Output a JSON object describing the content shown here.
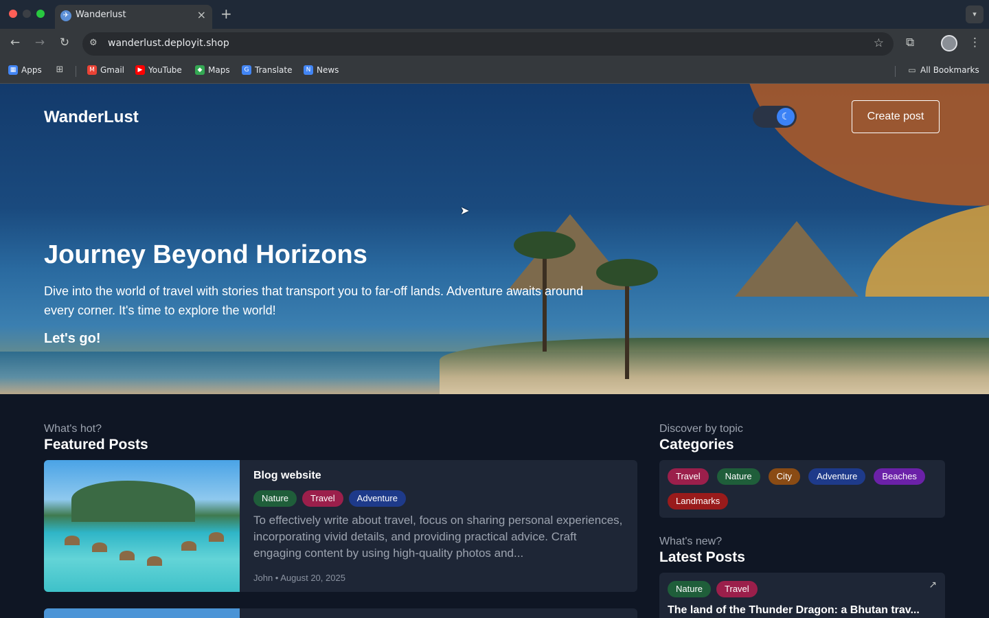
{
  "browser": {
    "tab_title": "Wanderlust",
    "tab_favicon": "globe-icon",
    "url": "wanderlust.deployit.shop",
    "bookmarks": {
      "apps": "Apps",
      "gmail": "Gmail",
      "youtube": "YouTube",
      "maps": "Maps",
      "translate": "Translate",
      "news": "News",
      "all": "All Bookmarks"
    }
  },
  "site": {
    "brand": "WanderLust",
    "create_post": "Create post",
    "theme_toggle": "on",
    "hero": {
      "title": "Journey Beyond Horizons",
      "subtitle": "Dive into the world of travel with stories that transport you to far-off lands. Adventure awaits around every corner. It's time to explore the world!",
      "cta": "Let's go!"
    },
    "featured": {
      "eyebrow": "What's hot?",
      "title": "Featured Posts",
      "posts": [
        {
          "title": "Blog website",
          "tags": [
            "Nature",
            "Travel",
            "Adventure"
          ],
          "excerpt": "To effectively write about travel, focus on sharing personal experiences, incorporating vivid details, and providing practical advice. Craft engaging content by using high-quality photos and...",
          "meta": "John • August 20, 2025"
        }
      ]
    },
    "categories": {
      "eyebrow": "Discover by topic",
      "title": "Categories",
      "items": [
        "Travel",
        "Nature",
        "City",
        "Adventure",
        "Beaches",
        "Landmarks"
      ]
    },
    "latest": {
      "eyebrow": "What's new?",
      "title": "Latest Posts",
      "posts": [
        {
          "tags": [
            "Nature",
            "Travel"
          ],
          "title": "The land of the Thunder Dragon: a Bhutan trav..."
        }
      ]
    }
  },
  "colors": {
    "nature": "#1f5e3a",
    "travel": "#9b1f4b",
    "adventure": "#1e3a8a",
    "city": "#8a4b14",
    "beaches": "#6b21a8",
    "landmarks": "#991b1b",
    "page_bg": "#0f1624",
    "card_bg": "#1e2636"
  }
}
